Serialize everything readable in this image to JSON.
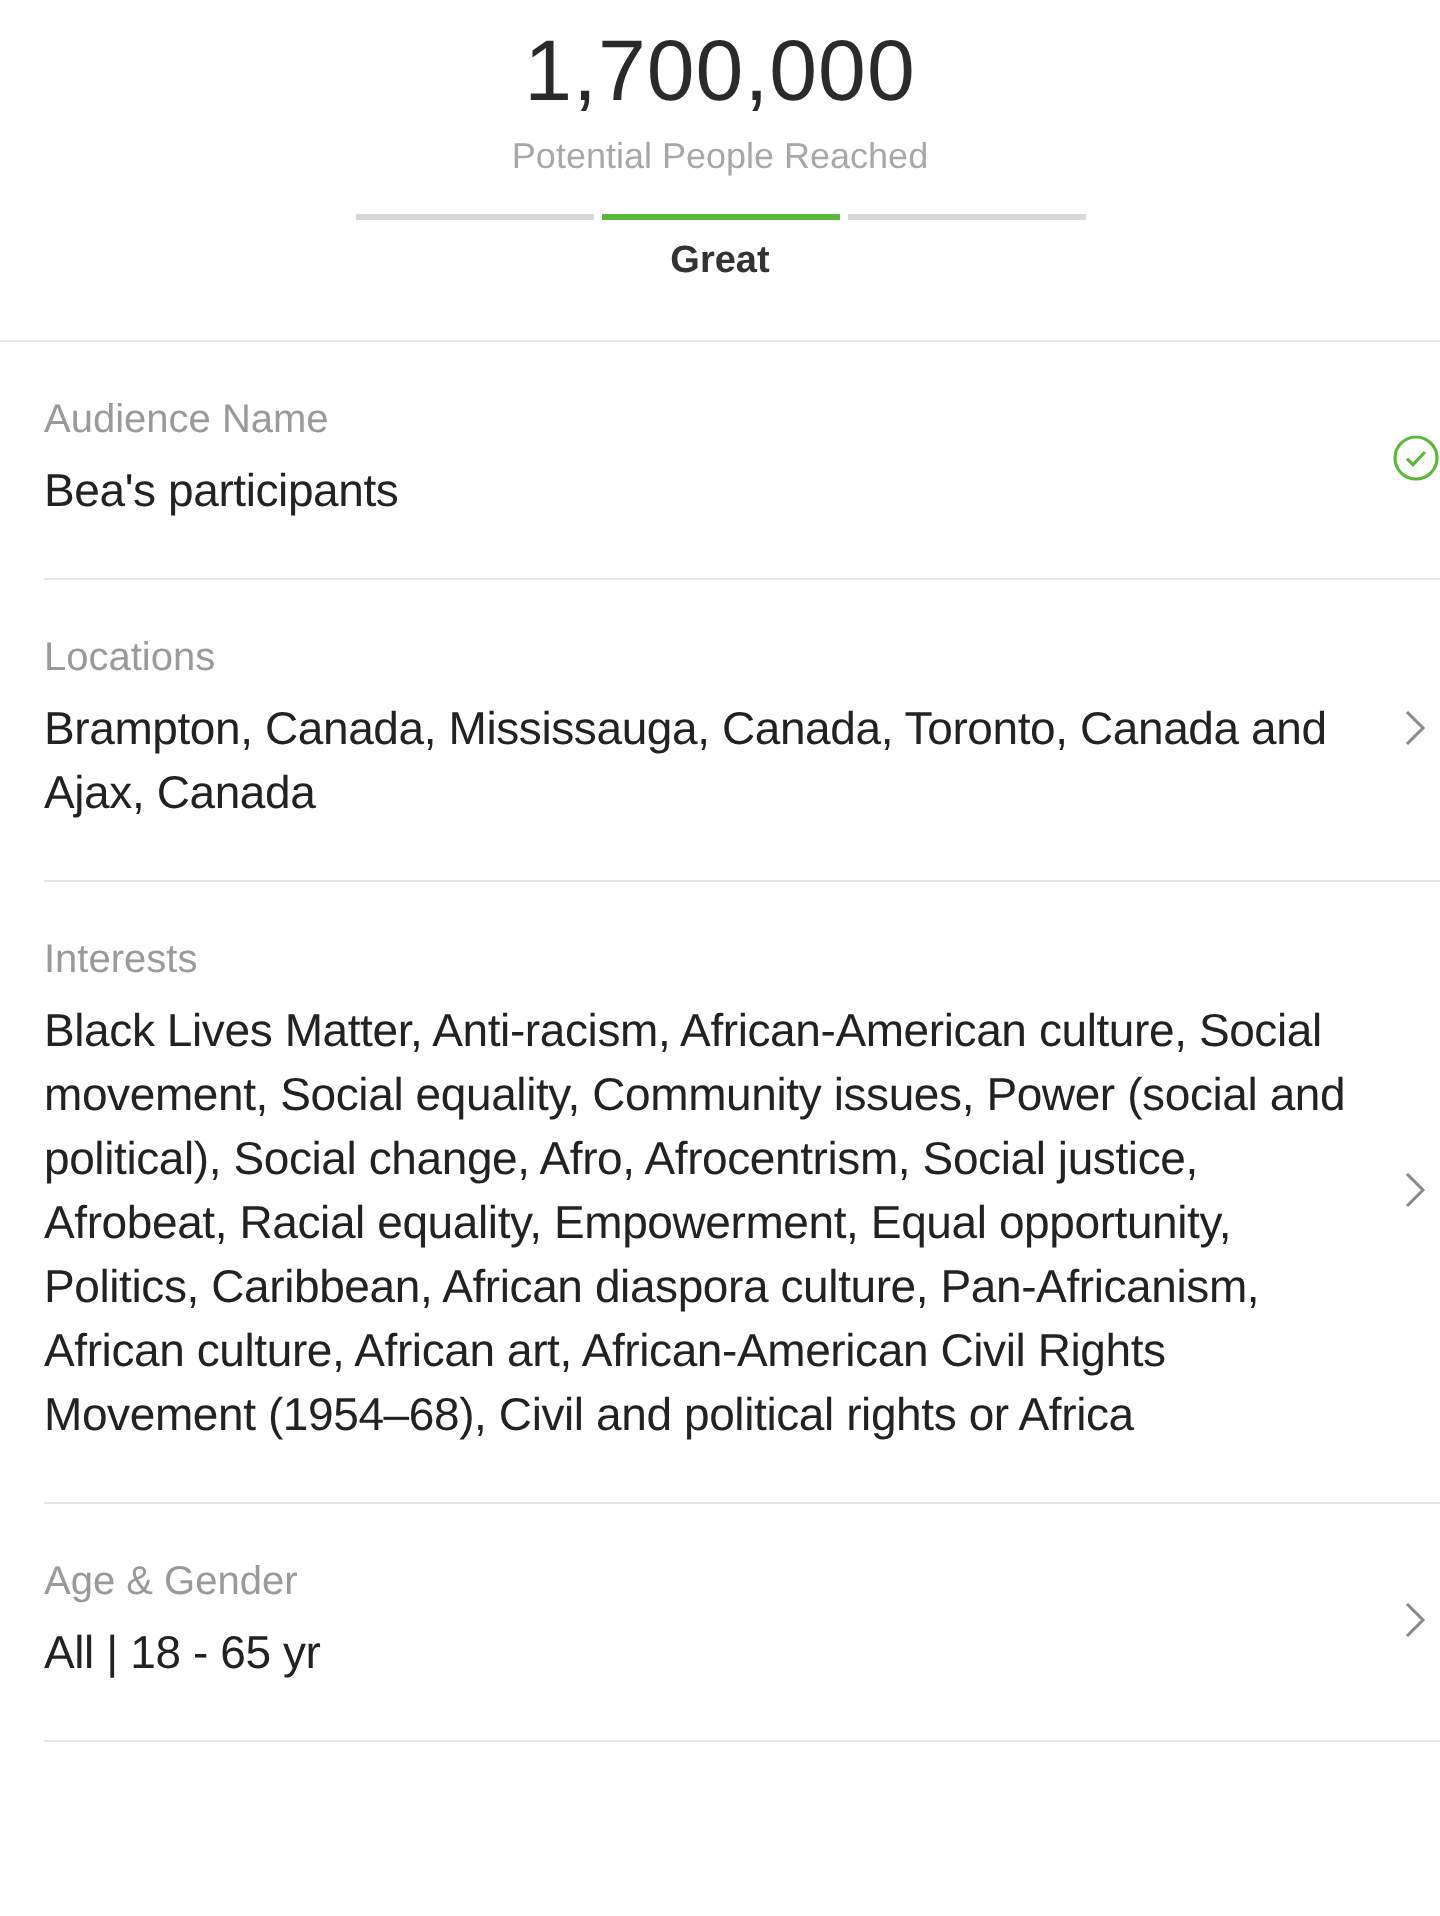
{
  "reach": {
    "value": "1,700,000",
    "caption": "Potential People Reached",
    "segments": [
      {
        "selected": false
      },
      {
        "selected": true
      },
      {
        "selected": false
      }
    ],
    "rating": "Great"
  },
  "rows": [
    {
      "kind": "check",
      "label": "Audience Name",
      "value": "Bea's participants"
    },
    {
      "kind": "chevron",
      "label": "Locations",
      "value": "Brampton, Canada, Mississauga, Canada, Toronto, Canada and Ajax, Canada"
    },
    {
      "kind": "chevron",
      "label": "Interests",
      "value": "Black Lives Matter, Anti-racism, African-American culture, Social movement, Social equality, Community issues, Power (social and political), Social change, Afro, Afrocentrism, Social justice, Afrobeat, Racial equality, Empowerment, Equal opportunity, Politics, Caribbean, African diaspora culture, Pan-Africanism, African culture, African art, African-American Civil Rights Movement (1954–68), Civil and political rights or Africa"
    },
    {
      "kind": "chevron",
      "label": "Age & Gender",
      "value": "All | 18 - 65 yr"
    }
  ]
}
